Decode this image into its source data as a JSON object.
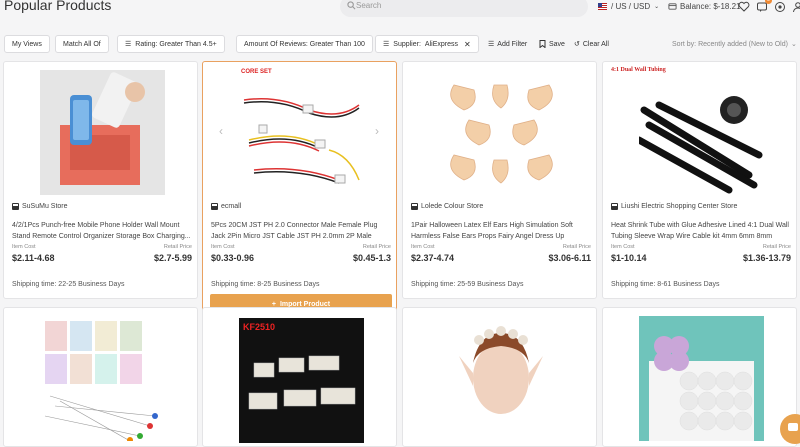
{
  "header": {
    "title": "Popular Products",
    "search_placeholder": "Search",
    "region": "/ US / USD",
    "balance": "Balance: $-18.21",
    "notification_count": "2"
  },
  "filters": {
    "my_views": "My Views",
    "match_all": "Match All Of",
    "rating": "Rating: Greater Than 4.5+",
    "reviews": "Amount Of Reviews: Greater Than 100",
    "supplier_label": "Supplier:",
    "supplier_value": "AliExpress",
    "add_filter": "Add Filter",
    "save": "Save",
    "clear_all": "Clear All",
    "sort_by": "Sort by: Recently added (New to Old)"
  },
  "labels": {
    "item_cost": "Item Cost",
    "retail_price": "Retail Price",
    "import_product": "Import Product",
    "core_set": "CORE SET",
    "kf_label": "KF2510",
    "dual_wall": "4:1 Dual Wall Tubing"
  },
  "products": [
    {
      "store": "SuSuMu Store",
      "title": "4/2/1Pcs Punch-free Mobile Phone Holder Wall Mount Stand Remote Control Organizer Storage Box Charging...",
      "cost": "$2.11-4.68",
      "retail": "$2.7-5.99",
      "shipping": "Shipping time: 22-25 Business Days"
    },
    {
      "store": "ecmall",
      "title": "5Pcs 20CM JST PH 2.0 Connector Male Female Plug Jack 2Pin Micro JST Cable JST PH 2.0mm 2P Male Female...",
      "cost": "$0.33-0.96",
      "retail": "$0.45-1.3",
      "shipping": "Shipping time: 8-25 Business Days"
    },
    {
      "store": "Lolede Colour Store",
      "title": "1Pair Halloween Latex Elf Ears High Simulation Soft Harmless False Ears Props Fairy Angel Dress Up Cosplay...",
      "cost": "$2.37-4.74",
      "retail": "$3.06-6.11",
      "shipping": "Shipping time: 25-59 Business Days"
    },
    {
      "store": "Liushi Electric Shopping Center Store",
      "title": "Heat Shrink Tube with Glue Adhesive Lined 4:1 Dual Wall Tubing Sleeve Wrap Wire Cable kit 4mm 6mm 8mm 12m...",
      "cost": "$1-10.14",
      "retail": "$1.36-13.79",
      "shipping": "Shipping time: 8-61 Business Days"
    }
  ]
}
